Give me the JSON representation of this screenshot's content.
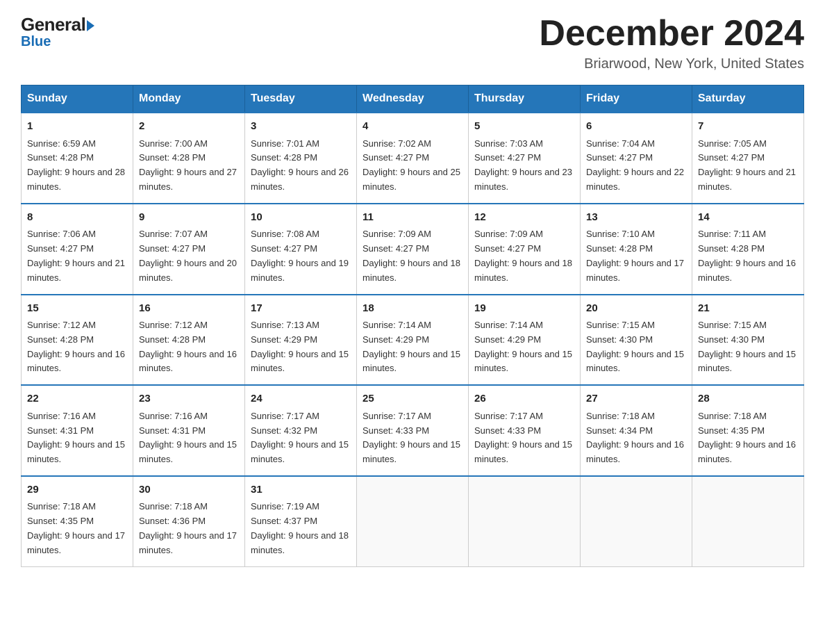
{
  "header": {
    "logo_general": "General",
    "logo_blue": "Blue",
    "month_title": "December 2024",
    "location": "Briarwood, New York, United States"
  },
  "days_of_week": [
    "Sunday",
    "Monday",
    "Tuesday",
    "Wednesday",
    "Thursday",
    "Friday",
    "Saturday"
  ],
  "weeks": [
    [
      {
        "day": "1",
        "sunrise": "6:59 AM",
        "sunset": "4:28 PM",
        "daylight": "9 hours and 28 minutes."
      },
      {
        "day": "2",
        "sunrise": "7:00 AM",
        "sunset": "4:28 PM",
        "daylight": "9 hours and 27 minutes."
      },
      {
        "day": "3",
        "sunrise": "7:01 AM",
        "sunset": "4:28 PM",
        "daylight": "9 hours and 26 minutes."
      },
      {
        "day": "4",
        "sunrise": "7:02 AM",
        "sunset": "4:27 PM",
        "daylight": "9 hours and 25 minutes."
      },
      {
        "day": "5",
        "sunrise": "7:03 AM",
        "sunset": "4:27 PM",
        "daylight": "9 hours and 23 minutes."
      },
      {
        "day": "6",
        "sunrise": "7:04 AM",
        "sunset": "4:27 PM",
        "daylight": "9 hours and 22 minutes."
      },
      {
        "day": "7",
        "sunrise": "7:05 AM",
        "sunset": "4:27 PM",
        "daylight": "9 hours and 21 minutes."
      }
    ],
    [
      {
        "day": "8",
        "sunrise": "7:06 AM",
        "sunset": "4:27 PM",
        "daylight": "9 hours and 21 minutes."
      },
      {
        "day": "9",
        "sunrise": "7:07 AM",
        "sunset": "4:27 PM",
        "daylight": "9 hours and 20 minutes."
      },
      {
        "day": "10",
        "sunrise": "7:08 AM",
        "sunset": "4:27 PM",
        "daylight": "9 hours and 19 minutes."
      },
      {
        "day": "11",
        "sunrise": "7:09 AM",
        "sunset": "4:27 PM",
        "daylight": "9 hours and 18 minutes."
      },
      {
        "day": "12",
        "sunrise": "7:09 AM",
        "sunset": "4:27 PM",
        "daylight": "9 hours and 18 minutes."
      },
      {
        "day": "13",
        "sunrise": "7:10 AM",
        "sunset": "4:28 PM",
        "daylight": "9 hours and 17 minutes."
      },
      {
        "day": "14",
        "sunrise": "7:11 AM",
        "sunset": "4:28 PM",
        "daylight": "9 hours and 16 minutes."
      }
    ],
    [
      {
        "day": "15",
        "sunrise": "7:12 AM",
        "sunset": "4:28 PM",
        "daylight": "9 hours and 16 minutes."
      },
      {
        "day": "16",
        "sunrise": "7:12 AM",
        "sunset": "4:28 PM",
        "daylight": "9 hours and 16 minutes."
      },
      {
        "day": "17",
        "sunrise": "7:13 AM",
        "sunset": "4:29 PM",
        "daylight": "9 hours and 15 minutes."
      },
      {
        "day": "18",
        "sunrise": "7:14 AM",
        "sunset": "4:29 PM",
        "daylight": "9 hours and 15 minutes."
      },
      {
        "day": "19",
        "sunrise": "7:14 AM",
        "sunset": "4:29 PM",
        "daylight": "9 hours and 15 minutes."
      },
      {
        "day": "20",
        "sunrise": "7:15 AM",
        "sunset": "4:30 PM",
        "daylight": "9 hours and 15 minutes."
      },
      {
        "day": "21",
        "sunrise": "7:15 AM",
        "sunset": "4:30 PM",
        "daylight": "9 hours and 15 minutes."
      }
    ],
    [
      {
        "day": "22",
        "sunrise": "7:16 AM",
        "sunset": "4:31 PM",
        "daylight": "9 hours and 15 minutes."
      },
      {
        "day": "23",
        "sunrise": "7:16 AM",
        "sunset": "4:31 PM",
        "daylight": "9 hours and 15 minutes."
      },
      {
        "day": "24",
        "sunrise": "7:17 AM",
        "sunset": "4:32 PM",
        "daylight": "9 hours and 15 minutes."
      },
      {
        "day": "25",
        "sunrise": "7:17 AM",
        "sunset": "4:33 PM",
        "daylight": "9 hours and 15 minutes."
      },
      {
        "day": "26",
        "sunrise": "7:17 AM",
        "sunset": "4:33 PM",
        "daylight": "9 hours and 15 minutes."
      },
      {
        "day": "27",
        "sunrise": "7:18 AM",
        "sunset": "4:34 PM",
        "daylight": "9 hours and 16 minutes."
      },
      {
        "day": "28",
        "sunrise": "7:18 AM",
        "sunset": "4:35 PM",
        "daylight": "9 hours and 16 minutes."
      }
    ],
    [
      {
        "day": "29",
        "sunrise": "7:18 AM",
        "sunset": "4:35 PM",
        "daylight": "9 hours and 17 minutes."
      },
      {
        "day": "30",
        "sunrise": "7:18 AM",
        "sunset": "4:36 PM",
        "daylight": "9 hours and 17 minutes."
      },
      {
        "day": "31",
        "sunrise": "7:19 AM",
        "sunset": "4:37 PM",
        "daylight": "9 hours and 18 minutes."
      },
      null,
      null,
      null,
      null
    ]
  ]
}
